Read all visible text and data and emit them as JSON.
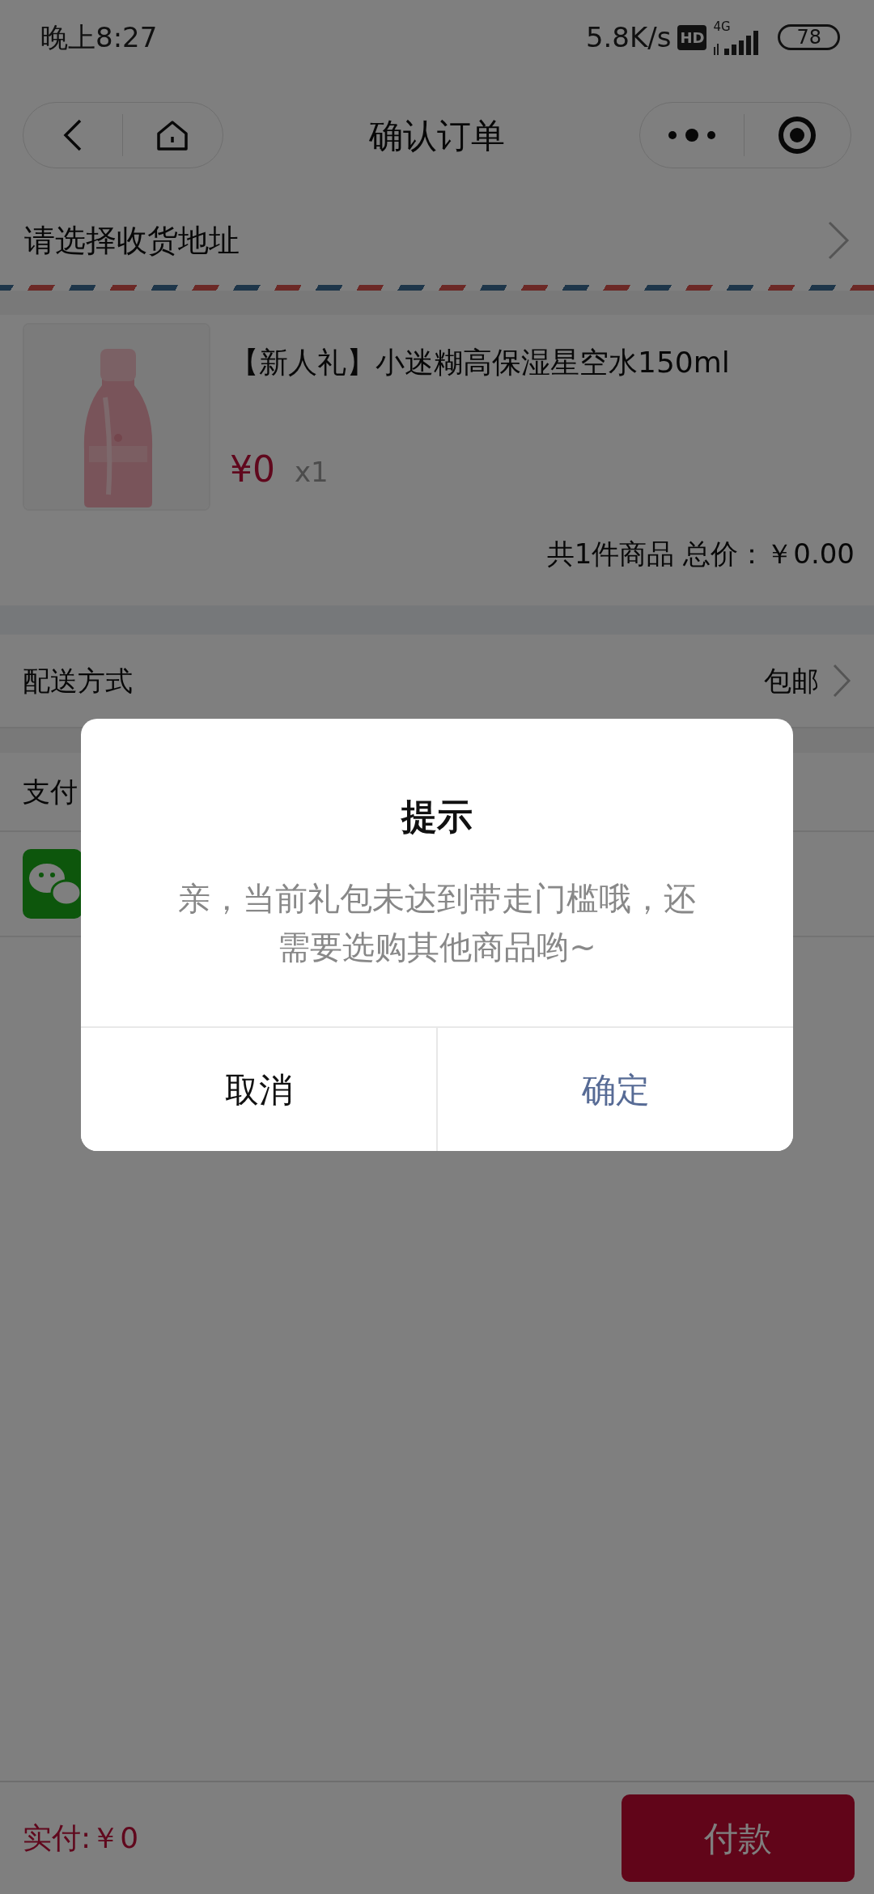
{
  "status_bar": {
    "time": "晚上8:27",
    "net_speed": "5.8K/s",
    "hd_badge": "HD",
    "network": "4G",
    "battery": "78"
  },
  "nav": {
    "title": "确认订单"
  },
  "address": {
    "label": "请选择收货地址"
  },
  "product": {
    "title": "【新人礼】小迷糊高保湿星空水150ml",
    "price": "¥0",
    "quantity": "x1"
  },
  "summary": "共1件商品 总价：￥0.00",
  "delivery": {
    "label": "配送方式",
    "value": "包邮"
  },
  "payment": {
    "label": "支付"
  },
  "bottom_bar": {
    "total": "实付:￥0",
    "pay_button": "付款"
  },
  "dialog": {
    "title": "提示",
    "message": "亲，当前礼包未达到带走门槛哦，还需要选购其他商品哟~",
    "buttons": [
      {
        "label": "取消",
        "kind": "cancel"
      },
      {
        "label": "确定",
        "kind": "confirm"
      }
    ]
  }
}
